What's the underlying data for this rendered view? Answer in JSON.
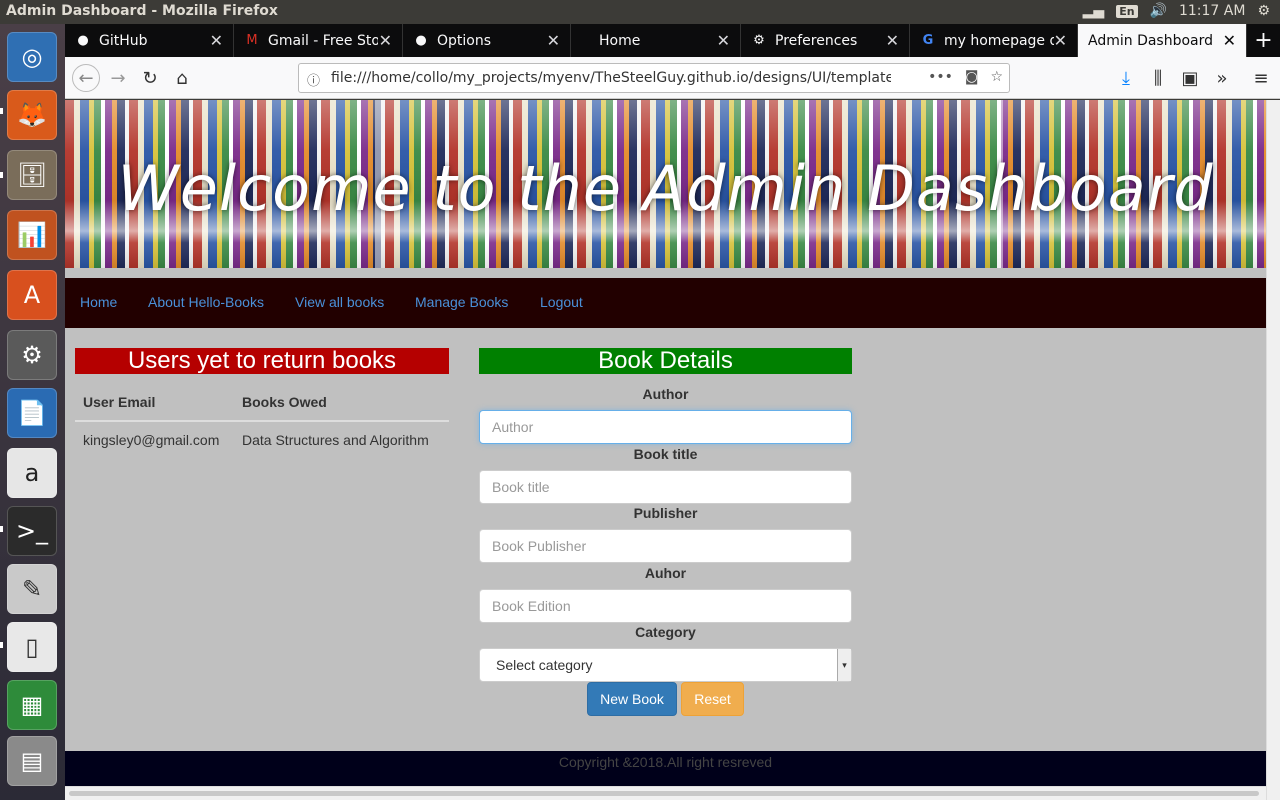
{
  "top_panel": {
    "window_title": "Admin Dashboard - Mozilla Firefox",
    "keyboard_layout": "En",
    "clock": "11:17 AM"
  },
  "launcher": {
    "items": [
      "ubuntu-dash",
      "firefox",
      "files",
      "impress",
      "software-center",
      "system-settings",
      "writer",
      "amazon",
      "terminal",
      "text-editor",
      "libreoffice",
      "calc",
      "workspaces"
    ]
  },
  "tabs": [
    {
      "label": "GitHub",
      "icon": "github-icon"
    },
    {
      "label": "Gmail - Free Stor",
      "icon": "gmail-icon"
    },
    {
      "label": "Options",
      "icon": "github-icon"
    },
    {
      "label": "Home",
      "icon": ""
    },
    {
      "label": "Preferences",
      "icon": "gear-icon"
    },
    {
      "label": "my homepage d",
      "icon": "google-icon"
    },
    {
      "label": "Admin Dashboard",
      "icon": "",
      "active": true
    }
  ],
  "url": "file:///home/collo/my_projects/myenv/TheSteelGuy.github.io/designs/UI/templates",
  "banner": {
    "title": "Welcome to the Admin Dashboard"
  },
  "menu": [
    "Home",
    "About Hello-Books",
    "View all books",
    "Manage Books",
    "Logout"
  ],
  "users_panel": {
    "title": "Users yet to return books",
    "headers": [
      "User Email",
      "Books Owed"
    ],
    "rows": [
      [
        "kingsley0@gmail.com",
        "Data Structures and Algorithm"
      ]
    ]
  },
  "book_form": {
    "title": "Book Details",
    "fields": [
      {
        "label": "Author",
        "placeholder": "Author"
      },
      {
        "label": "Book title",
        "placeholder": "Book title"
      },
      {
        "label": "Publisher",
        "placeholder": "Book Publisher"
      },
      {
        "label": "Auhor",
        "placeholder": "Book Edition"
      }
    ],
    "category_label": "Category",
    "category_value": "Select category",
    "new_button": "New Book",
    "reset_button": "Reset"
  },
  "footer": "Copyright &2018.All right resreved",
  "colors": {
    "menubar": "#220000",
    "users_head": "#b50000",
    "book_head": "#008000",
    "page_bg": "#c0c0c0",
    "link": "#4a90d9"
  }
}
